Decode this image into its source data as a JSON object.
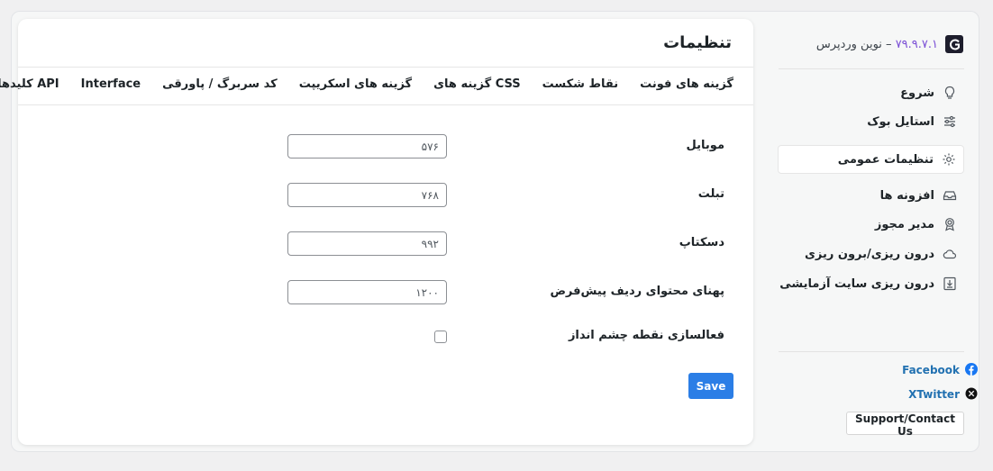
{
  "header": {
    "title": "تنظیمات"
  },
  "tabs": [
    {
      "label": "گزینه های فونت"
    },
    {
      "label": "نقاط شکست",
      "active": true
    },
    {
      "label": "گزینه های CSS"
    },
    {
      "label": "گزینه های اسکریپت"
    },
    {
      "label": "کد سربرگ / پاورقی"
    },
    {
      "label": "Interface"
    },
    {
      "label": "کلیدهای API"
    }
  ],
  "form": {
    "mobile": {
      "label": "موبایل",
      "value": "۵۷۶"
    },
    "tablet": {
      "label": "تبلت",
      "value": "۷۶۸"
    },
    "desktop": {
      "label": "دسکتاپ",
      "value": "۹۹۲"
    },
    "row_width": {
      "label": "پهنای محتوای ردیف پیش‌فرض",
      "value": "۱۲۰۰"
    },
    "eye_breakpoint": {
      "label": "فعالسازی نقطه چشم انداز",
      "checked": false
    },
    "save_label": "Save"
  },
  "sidebar": {
    "brand": {
      "version": "۷۹.۹.۷.۱",
      "name": "– نوین وردپرس"
    },
    "items": [
      {
        "label": "شروع",
        "icon": "lightbulb-icon"
      },
      {
        "label": "استایل بوک",
        "icon": "sliders-icon"
      },
      {
        "label": "تنظیمات عمومی",
        "icon": "gear-icon",
        "active": true
      },
      {
        "label": "افزونه ها",
        "icon": "inbox-icon"
      },
      {
        "label": "مدیر مجوز",
        "icon": "award-icon"
      },
      {
        "label": "درون ریزی/برون ریزی",
        "icon": "cloud-icon"
      },
      {
        "label": "درون ریزی سایت آزمایشی",
        "icon": "download-icon"
      }
    ],
    "social": {
      "facebook": "Facebook",
      "twitter": "XTwitter"
    },
    "support_label": "Support/Contact Us"
  },
  "colors": {
    "accent": "#2b7ee6",
    "version": "#7b4fd6",
    "link": "#2271b1",
    "facebook": "#1877f2"
  }
}
